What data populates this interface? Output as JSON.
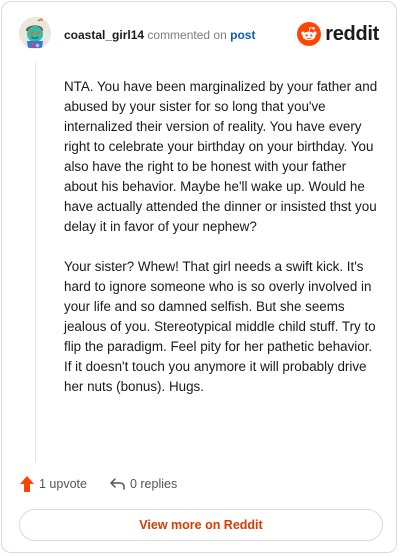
{
  "header": {
    "username": "coastal_girl14",
    "action_text": "commented on",
    "post_link": "post",
    "brand": "reddit"
  },
  "comment": {
    "paragraphs": [
      "NTA. You have been marginalized by your father and abused by your sister for so long that you've internalized their version of reality. You have every right to celebrate your birthday on your birthday. You also have the right to be honest with your father about his behavior. Maybe he'll wake up. Would he have actually attended the dinner or insisted thst you delay it in favor of your nephew?",
      "Your sister? Whew! That girl needs a swift kick. It's hard to ignore someone who is so overly involved in your life and so damned selfish. But she seems jealous of you. Stereotypical middle child stuff. Try to flip the paradigm. Feel pity for her pathetic behavior. If it doesn't touch you anymore it will probably drive her nuts (bonus). Hugs."
    ]
  },
  "actions": {
    "upvotes": "1 upvote",
    "replies": "0 replies"
  },
  "footer": {
    "view_more": "View more on Reddit"
  },
  "colors": {
    "brand_orange": "#ff4500",
    "link_blue": "#0b5bb5",
    "view_more_text": "#d93a00"
  },
  "icons": {
    "avatar": "snoo-avatar",
    "brand": "reddit-logo-icon",
    "upvote": "upvote-arrow-icon",
    "reply": "reply-arrow-icon"
  }
}
